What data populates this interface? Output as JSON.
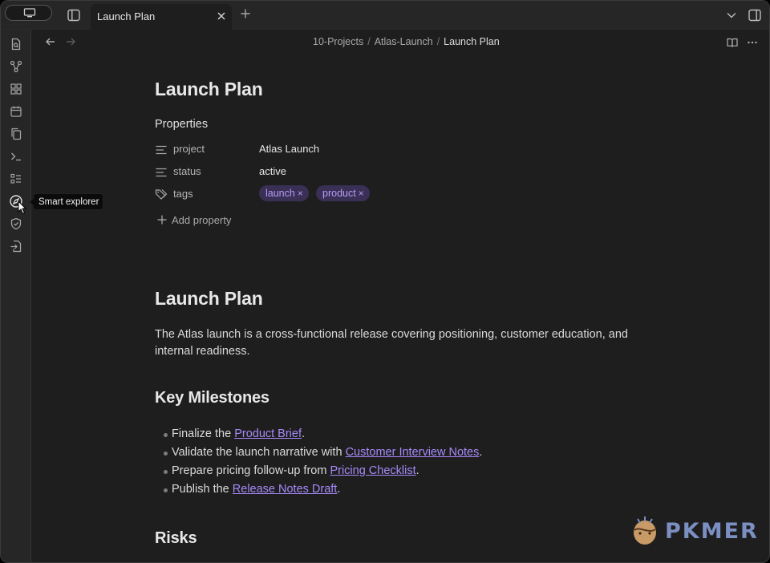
{
  "tab": {
    "title": "Launch Plan"
  },
  "breadcrumb": {
    "folder1": "10-Projects",
    "folder2": "Atlas-Launch",
    "current": "Launch Plan",
    "separator": "/"
  },
  "tooltip": {
    "label": "Smart explorer"
  },
  "note": {
    "inline_title": "Launch Plan",
    "properties_heading": "Properties",
    "properties": [
      {
        "key": "project",
        "value": "Atlas Launch",
        "icon": "text-lines-icon"
      },
      {
        "key": "status",
        "value": "active",
        "icon": "text-lines-icon"
      },
      {
        "key": "tags",
        "icon": "tags-icon",
        "tags": [
          "launch",
          "product"
        ]
      }
    ],
    "tag_remove_glyph": "×",
    "add_property_label": "Add property",
    "h1": "Launch Plan",
    "intro": "The Atlas launch is a cross-functional release covering positioning, customer education, and internal readiness.",
    "milestones_heading": "Key Milestones",
    "milestones": [
      {
        "before": "Finalize the ",
        "link": "Product Brief",
        "after": "."
      },
      {
        "before": "Validate the launch narrative with ",
        "link": "Customer Interview Notes",
        "after": "."
      },
      {
        "before": "Prepare pricing follow-up from ",
        "link": "Pricing Checklist",
        "after": "."
      },
      {
        "before": "Publish the ",
        "link": "Release Notes Draft",
        "after": "."
      }
    ],
    "risks_heading": "Risks"
  },
  "watermark": {
    "text": "PKMER"
  },
  "colors": {
    "accent": "#a68af9",
    "tag_bg": "#3a2f55",
    "background": "#1e1e1e",
    "chrome": "#262626"
  }
}
